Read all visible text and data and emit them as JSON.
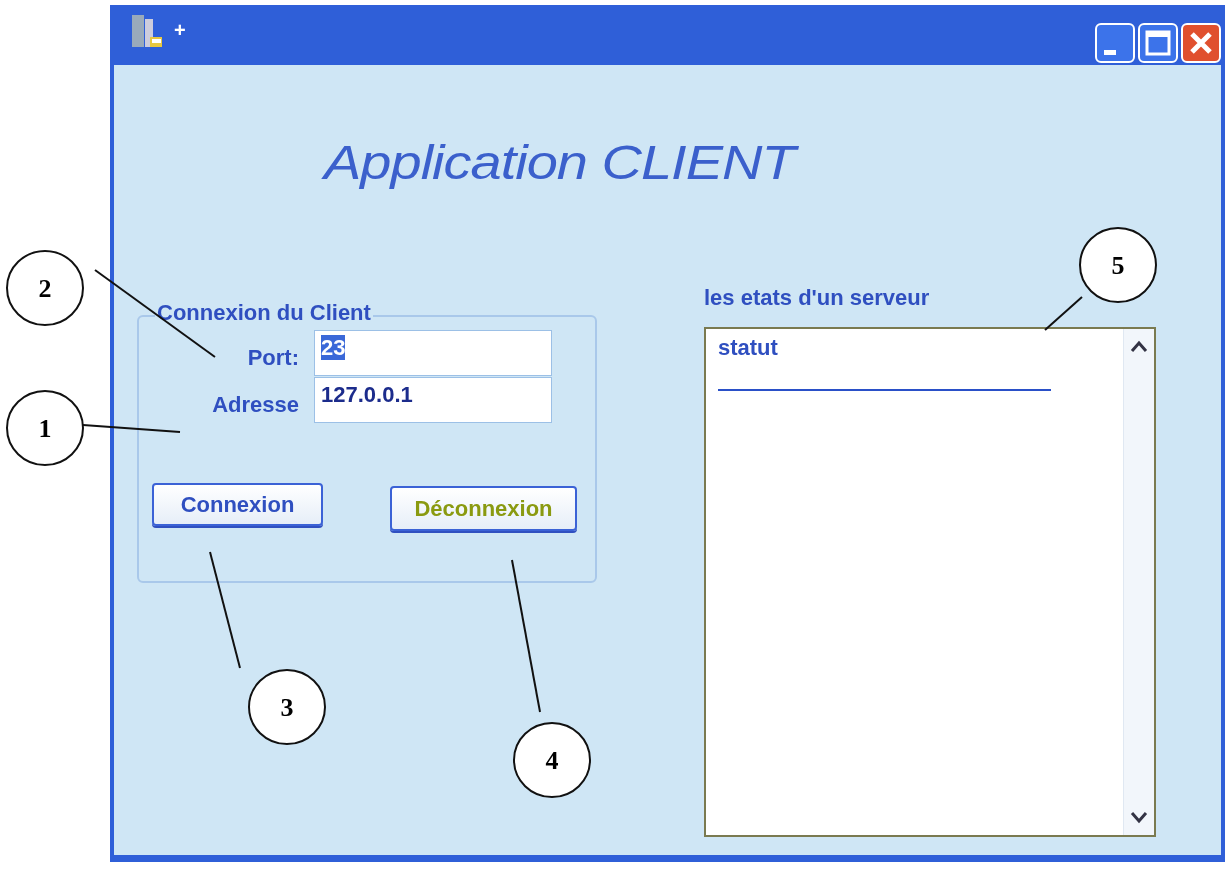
{
  "window": {
    "title": "+"
  },
  "heading": "Application CLIENT",
  "connection_group": {
    "legend": "Connexion du Client",
    "fields": [
      {
        "label": "Port:",
        "value": "23",
        "selected": true
      },
      {
        "label": "Adresse",
        "value": "127.0.0.1",
        "selected": false
      }
    ],
    "buttons": [
      {
        "label": "Connexion",
        "hot": false
      },
      {
        "label": "Déconnexion",
        "hot": true
      }
    ]
  },
  "server_states": {
    "label": "les etats d'un serveur",
    "items": [
      "statut"
    ]
  },
  "annotations": [
    {
      "label": "1"
    },
    {
      "label": "2"
    },
    {
      "label": "3"
    },
    {
      "label": "4"
    },
    {
      "label": "5"
    }
  ]
}
